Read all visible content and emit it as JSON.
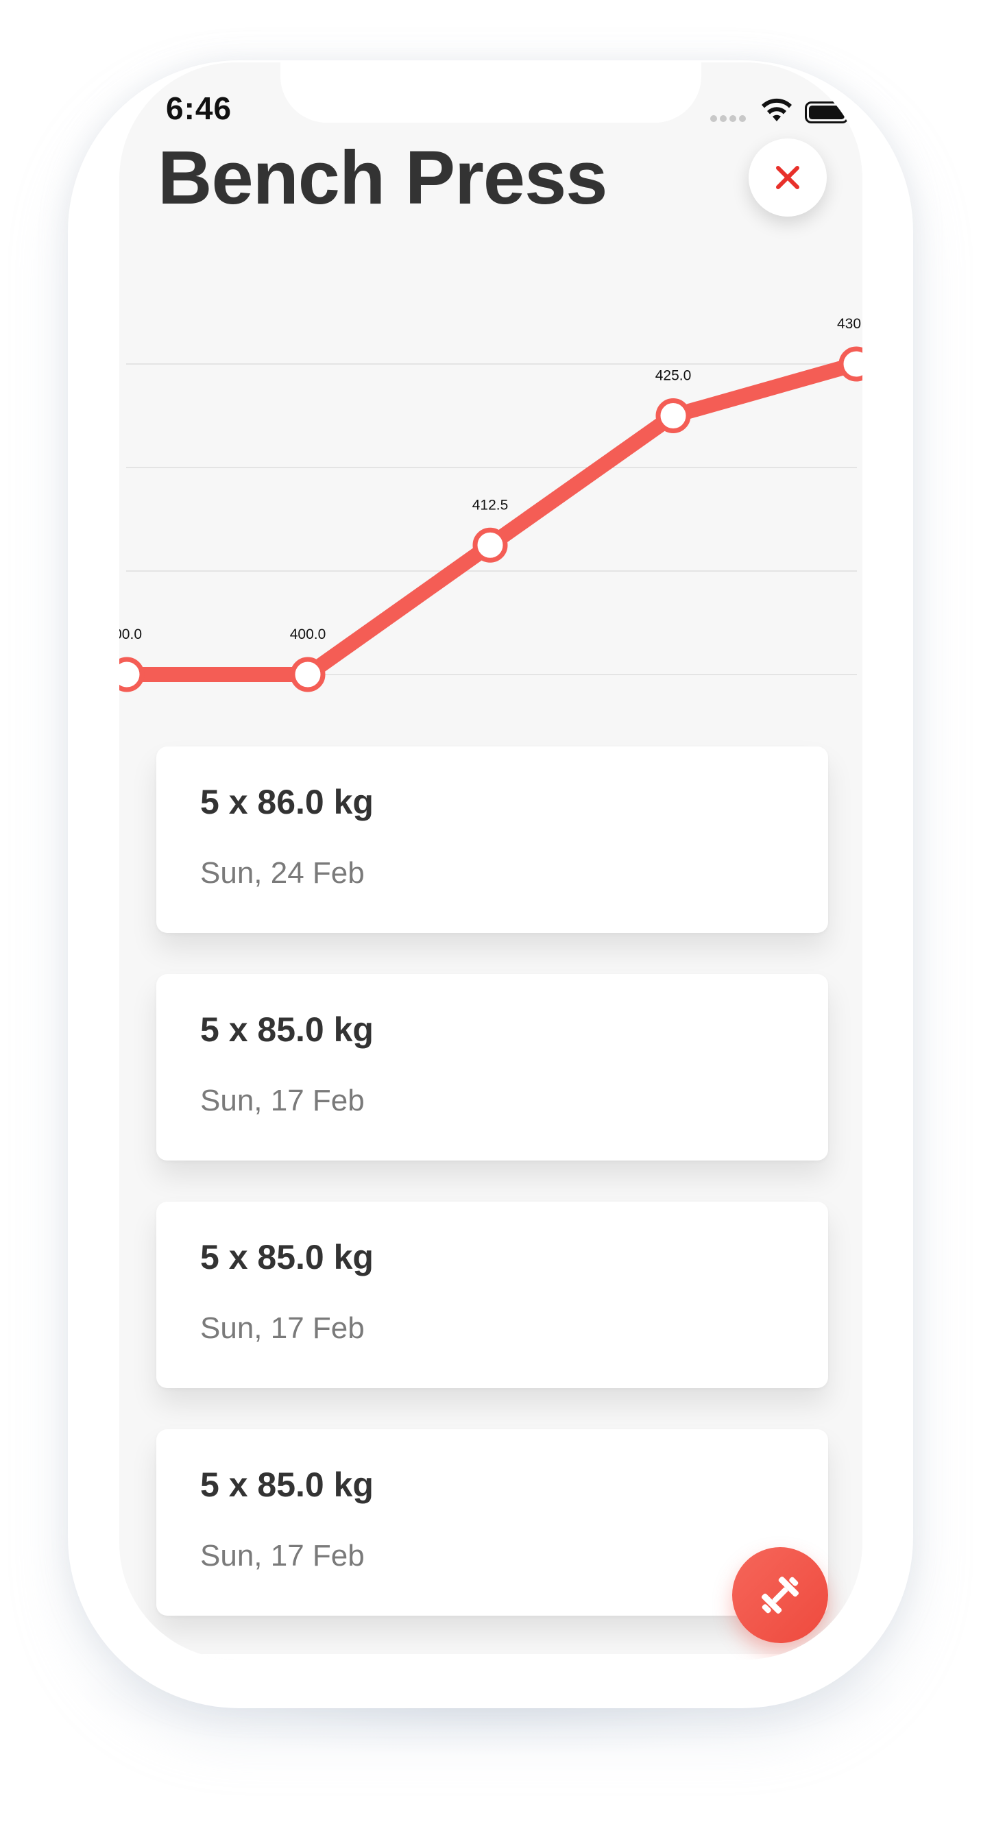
{
  "status_bar": {
    "time": "6:46"
  },
  "header": {
    "title": "Bench Press",
    "close_icon": "close-icon"
  },
  "chart_data": {
    "type": "line",
    "x": [
      "1",
      "2",
      "3",
      "4",
      "5"
    ],
    "series": [
      {
        "values": [
          400.0,
          400.0,
          412.5,
          425.0,
          430.0
        ],
        "labels": [
          "00.0",
          "400.0",
          "412.5",
          "425.0",
          "430"
        ]
      }
    ],
    "grid": true,
    "color": "#f45d55"
  },
  "sets": [
    {
      "weight": "5 x 86.0 kg",
      "date": "Sun, 24 Feb"
    },
    {
      "weight": "5 x 85.0 kg",
      "date": "Sun, 17 Feb"
    },
    {
      "weight": "5 x 85.0 kg",
      "date": "Sun, 17 Feb"
    },
    {
      "weight": "5 x 85.0 kg",
      "date": "Sun, 17 Feb"
    }
  ],
  "fab": {
    "icon": "dumbbell-icon"
  },
  "colors": {
    "accent": "#f45d55",
    "close": "#e8302a",
    "text": "#333333",
    "muted": "#7a7a7a",
    "background": "#f7f7f7"
  }
}
